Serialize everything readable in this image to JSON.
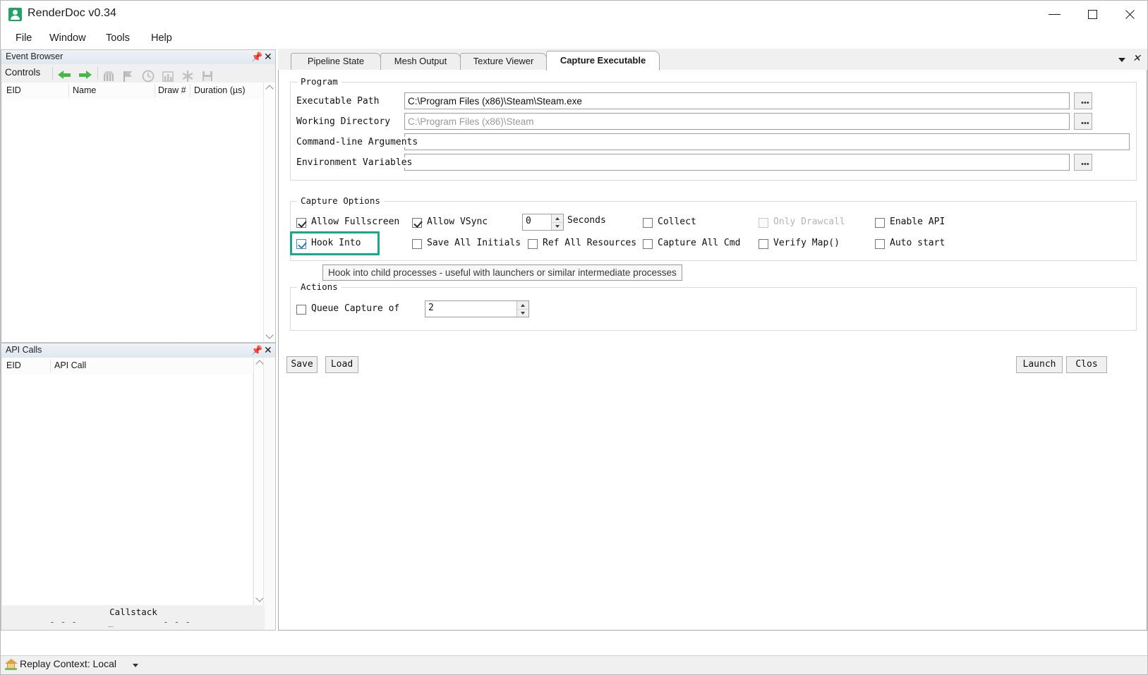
{
  "window": {
    "title": "RenderDoc v0.34",
    "icon": "renderdoc-logo-icon",
    "minimize": "—",
    "maximize": "□",
    "close": "✕"
  },
  "menubar": {
    "items": [
      {
        "label": "File"
      },
      {
        "label": "Window"
      },
      {
        "label": "Tools"
      },
      {
        "label": "Help"
      }
    ]
  },
  "event_browser": {
    "title": "Event Browser",
    "controls_label": "Controls",
    "toolbar_icons": [
      "back-arrow-icon",
      "forward-arrow-icon",
      "bookmark-icon",
      "flag-icon",
      "timeline-icon",
      "histogram-icon",
      "asterisk-icon",
      "save-icon"
    ],
    "columns": [
      "EID",
      "Name",
      "Draw #",
      "Duration (µs)"
    ],
    "rows": []
  },
  "api_calls": {
    "title": "API Calls",
    "columns": [
      "EID",
      "API Call"
    ],
    "rows": [],
    "callstack_label": "Callstack"
  },
  "statusbar": {
    "icon": "home-icon",
    "text": "Replay Context: Local",
    "dropdown": "chevron-down-icon"
  },
  "tabs": {
    "items": [
      {
        "label": "Pipeline State",
        "active": false
      },
      {
        "label": "Mesh Output",
        "active": false
      },
      {
        "label": "Texture Viewer",
        "active": false
      },
      {
        "label": "Capture Executable",
        "active": true
      }
    ],
    "dropdown_icon": "chevron-down-icon",
    "close_icon": "close-icon"
  },
  "capture_executable": {
    "program": {
      "group_title": "Program",
      "fields": [
        {
          "label": "Executable Path",
          "value": "C:\\Program Files (x86)\\Steam\\Steam.exe",
          "placeholder": "",
          "browse": "..."
        },
        {
          "label": "Working Directory",
          "value": "",
          "placeholder": "C:\\Program Files (x86)\\Steam",
          "browse": "..."
        },
        {
          "label": "Command-line Arguments",
          "value": "",
          "placeholder": "",
          "browse": ""
        },
        {
          "label": "Environment Variables",
          "value": "",
          "placeholder": "",
          "browse": "..."
        }
      ]
    },
    "capture_options": {
      "group_title": "Capture Options",
      "checkboxes": [
        {
          "label": "Allow Fullscreen",
          "checked": true,
          "disabled": false,
          "highlight": false,
          "blue": false
        },
        {
          "label": "Allow VSync",
          "checked": true,
          "disabled": false,
          "highlight": false,
          "blue": false
        },
        {
          "label": "Collect",
          "checked": false,
          "disabled": false,
          "highlight": false,
          "blue": false
        },
        {
          "label": "Only Drawcall",
          "checked": false,
          "disabled": true,
          "highlight": false,
          "blue": false
        },
        {
          "label": "Enable API",
          "checked": false,
          "disabled": false,
          "highlight": false,
          "blue": false
        },
        {
          "label": "Hook Into",
          "checked": true,
          "disabled": false,
          "highlight": true,
          "blue": true
        },
        {
          "label": "Save All Initials",
          "checked": false,
          "disabled": false,
          "highlight": false,
          "blue": false
        },
        {
          "label": "Ref All Resources",
          "checked": false,
          "disabled": false,
          "highlight": false,
          "blue": false
        },
        {
          "label": "Capture All Cmd",
          "checked": false,
          "disabled": false,
          "highlight": false,
          "blue": false
        },
        {
          "label": "Verify Map()",
          "checked": false,
          "disabled": false,
          "highlight": false,
          "blue": false
        },
        {
          "label": "Auto start",
          "checked": false,
          "disabled": false,
          "highlight": false,
          "blue": false
        }
      ],
      "delay_value": "0",
      "delay_label": "Seconds"
    },
    "tooltip": "Hook into child processes - useful with launchers or similar intermediate processes",
    "actions": {
      "group_title": "Actions",
      "queue_capture_label": "Queue Capture of",
      "queue_capture_checked": false,
      "queue_capture_value": "2"
    },
    "buttons": {
      "save": "Save",
      "load": "Load",
      "launch": "Launch",
      "close": "Clos"
    }
  },
  "colors": {
    "highlight_teal": "#18a890",
    "accent_green": "#49b649",
    "brand_green": "#21a366",
    "window_bg": "#f0f0f0",
    "panel_bg": "#ffffff"
  }
}
